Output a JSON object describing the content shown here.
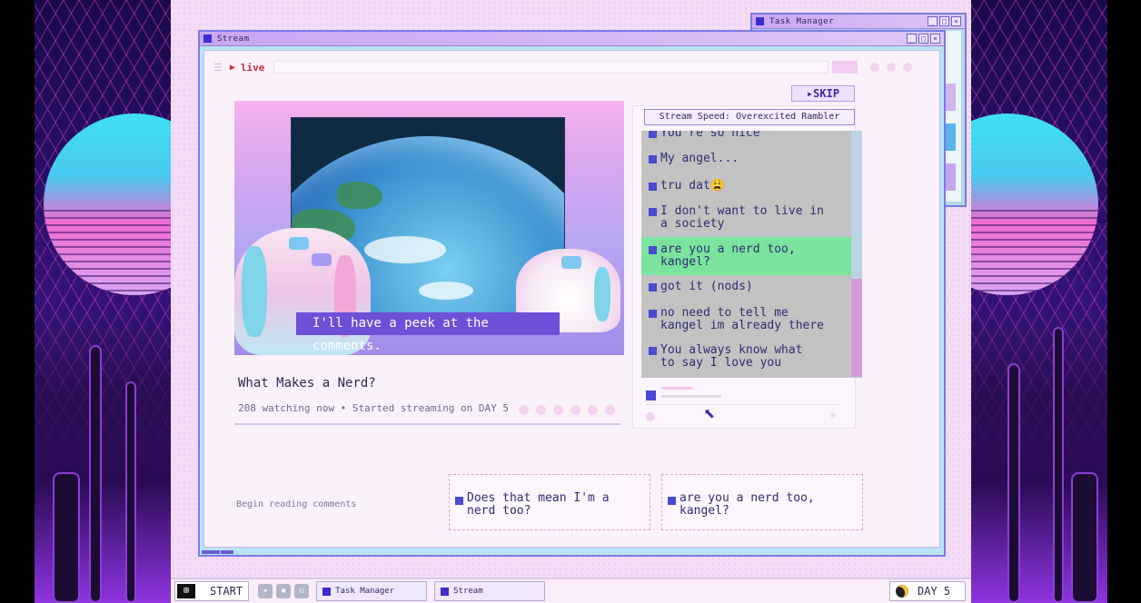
{
  "task_manager_window": {
    "title": "Task Manager"
  },
  "stream_window": {
    "title": "Stream",
    "live_label": "live",
    "subtitle": "I'll have a peek at the comments.",
    "video_title": "What Makes a Nerd?",
    "meta": "208 watching now  •  Started streaming on DAY 5",
    "skip_label": "SKIP",
    "speed_label": "Stream Speed: Overexcited Rambler",
    "comments": [
      {
        "text": "You're so nice"
      },
      {
        "text": "My angel..."
      },
      {
        "text": "tru dat😩"
      },
      {
        "text": "I don't want to live in\na society"
      },
      {
        "text": "are you a nerd too,\nkangel?",
        "highlighted": true
      },
      {
        "text": "got it (nods)"
      },
      {
        "text": "no need to tell me\nkangel im already there"
      },
      {
        "text": "You always know what\nto say I love you"
      }
    ],
    "begin_label": "Begin reading comments",
    "options": [
      {
        "text": "Does that mean I'm a\nnerd too?"
      },
      {
        "text": "are you a nerd too,\nkangel?"
      }
    ]
  },
  "taskbar": {
    "start_label": "START",
    "tasks": [
      {
        "label": "Task Manager"
      },
      {
        "label": "Stream"
      }
    ],
    "day_label": "DAY 5"
  },
  "colors": {
    "accent": "#3d2bd0",
    "live": "#d02a3a",
    "highlight": "#7be39e",
    "desktop": "#f4dcf6"
  },
  "icons": [
    "hamburger-icon",
    "play-icon",
    "cursor-icon",
    "twitter-icon",
    "chat-icon",
    "computer-icon",
    "moon-icon"
  ]
}
